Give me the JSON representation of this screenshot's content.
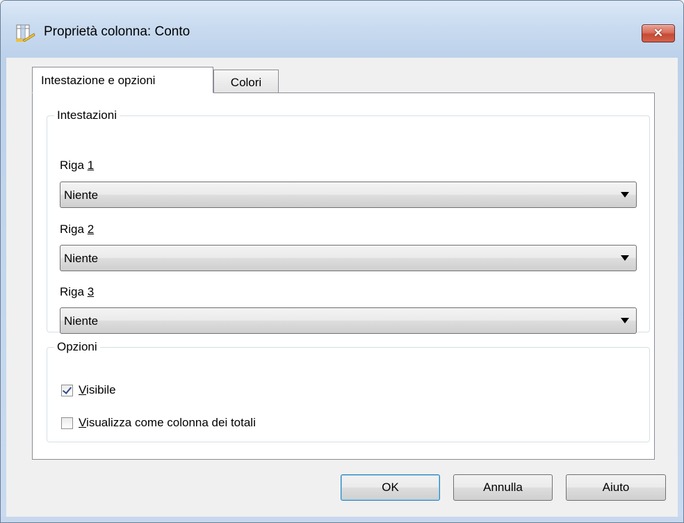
{
  "window": {
    "title": "Proprietà colonna: Conto",
    "close_label": "✕"
  },
  "tabs": [
    {
      "label": "Intestazione e opzioni",
      "active": true
    },
    {
      "label": "Colori",
      "active": false
    }
  ],
  "headers_group": {
    "legend": "Intestazioni",
    "rows": [
      {
        "label_prefix": "Riga ",
        "label_key": "1",
        "value": "Niente"
      },
      {
        "label_prefix": "Riga ",
        "label_key": "2",
        "value": "Niente"
      },
      {
        "label_prefix": "Riga ",
        "label_key": "3",
        "value": "Niente"
      }
    ]
  },
  "options_group": {
    "legend": "Opzioni",
    "visible": {
      "key": "V",
      "rest": "isibile",
      "checked": true
    },
    "totals": {
      "key": "V",
      "rest": "isualizza come colonna dei totali",
      "checked": false
    }
  },
  "buttons": {
    "ok": "OK",
    "cancel": "Annulla",
    "help": "Aiuto"
  }
}
